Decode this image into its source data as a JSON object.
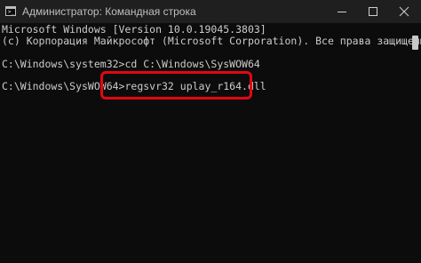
{
  "window": {
    "title": "Администратор: Командная строка",
    "app_icon_glyph": ">_"
  },
  "console": {
    "lines": [
      "Microsoft Windows [Version 10.0.19045.3803]",
      "(c) Корпорация Майкрософт (Microsoft Corporation). Все права защищены.",
      "",
      "C:\\Windows\\system32>cd C:\\Windows\\SysWOW64",
      "",
      "C:\\Windows\\SysWOW64>regsvr32 uplay_r164.dll"
    ]
  },
  "colors": {
    "background": "#0c0c0c",
    "titlebar": "#1f1f1f",
    "text": "#cccccc",
    "highlight": "#e30613"
  },
  "icons": {
    "minimize": "minimize-icon",
    "maximize": "maximize-icon",
    "close": "close-icon"
  }
}
